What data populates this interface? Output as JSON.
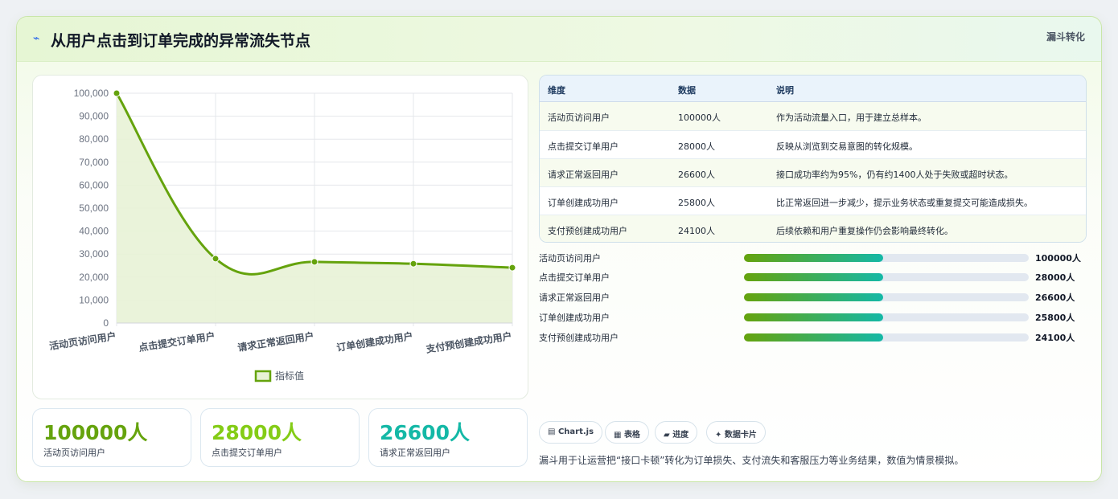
{
  "header": {
    "icon": "chart-line-icon",
    "title": "从用户点击到订单完成的异常流失节点",
    "tag": "漏斗转化"
  },
  "chart_data": {
    "type": "line",
    "categories": [
      "活动页访问用户",
      "点击提交订单用户",
      "请求正常返回用户",
      "订单创建成功用户",
      "支付预创建成功用户"
    ],
    "series": [
      {
        "name": "指标值",
        "values": [
          100000,
          28000,
          26600,
          25800,
          24100
        ]
      }
    ],
    "ylim": [
      0,
      100000
    ],
    "yticks": [
      "100,000",
      "90,000",
      "80,000",
      "70,000",
      "60,000",
      "50,000",
      "40,000",
      "30,000",
      "20,000",
      "10,000",
      "0"
    ],
    "fill": true,
    "legend": "bottom",
    "line_color": "#65a30d",
    "fill_color": "#e8f2d6"
  },
  "kpis": [
    {
      "value": "100000人",
      "label": "活动页访问用户",
      "color": "#65a30d"
    },
    {
      "value": "28000人",
      "label": "点击提交订单用户",
      "color": "#84cc16"
    },
    {
      "value": "26600人",
      "label": "请求正常返回用户",
      "color": "#14b8a6"
    }
  ],
  "table": {
    "headers": [
      "维度",
      "数据",
      "说明"
    ],
    "rows": [
      [
        "活动页访问用户",
        "100000人",
        "作为活动流量入口，用于建立总样本。"
      ],
      [
        "点击提交订单用户",
        "28000人",
        "反映从浏览到交易意图的转化规模。"
      ],
      [
        "请求正常返回用户",
        "26600人",
        "接口成功率约为95%，仍有约1400人处于失败或超时状态。"
      ],
      [
        "订单创建成功用户",
        "25800人",
        "比正常返回进一步减少，提示业务状态或重复提交可能造成损失。"
      ],
      [
        "支付预创建成功用户",
        "24100人",
        "后续依赖和用户重复操作仍会影响最终转化。"
      ]
    ]
  },
  "progress": [
    {
      "label": "活动页访问用户",
      "value": "100000人",
      "fraction": 0.49
    },
    {
      "label": "点击提交订单用户",
      "value": "28000人",
      "fraction": 0.49
    },
    {
      "label": "请求正常返回用户",
      "value": "26600人",
      "fraction": 0.49
    },
    {
      "label": "订单创建成功用户",
      "value": "25800人",
      "fraction": 0.49
    },
    {
      "label": "支付预创建成功用户",
      "value": "24100人",
      "fraction": 0.49
    }
  ],
  "chips": [
    {
      "icon": "chart-icon",
      "glyph": "▤",
      "label": "Chart.js"
    },
    {
      "icon": "table-icon",
      "glyph": "▦",
      "label": "表格"
    },
    {
      "icon": "progress-icon",
      "glyph": "▰",
      "label": "进度"
    },
    {
      "icon": "data-card-icon",
      "glyph": "✦",
      "label": "数据卡片"
    }
  ],
  "note": "漏斗用于让运营把“接口卡顿”转化为订单损失、支付流失和客服压力等业务结果，数值为情景模拟。"
}
